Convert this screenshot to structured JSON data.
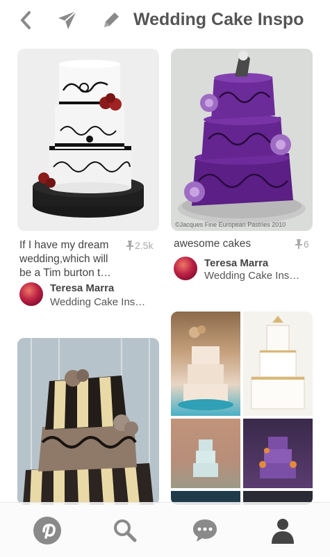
{
  "header": {
    "title": "Wedding Cake Inspo",
    "back_icon": "chevron-left-icon",
    "send_icon": "send-icon",
    "edit_icon": "pencil-icon"
  },
  "pins": [
    {
      "caption": "If I have my dream wedding,which will be a Tim burton t…",
      "saves": "2.5k",
      "user": "Teresa Marra",
      "board": "Wedding Cake Ins…"
    },
    {
      "caption": "awesome cakes",
      "saves": "6",
      "watermark": "©Jacques Fine European Pastries 2010",
      "user": "Teresa Marra",
      "board": "Wedding Cake Ins…"
    }
  ],
  "tabbar": {
    "items": [
      "pinterest-logo-icon",
      "search-icon",
      "chat-bubble-icon",
      "profile-icon"
    ]
  },
  "colors": {
    "accent_purple": "#6b2f93",
    "pin_grey": "#aaaaaa",
    "tab_icon": "#8a8a8a",
    "tab_active": "#444444"
  }
}
